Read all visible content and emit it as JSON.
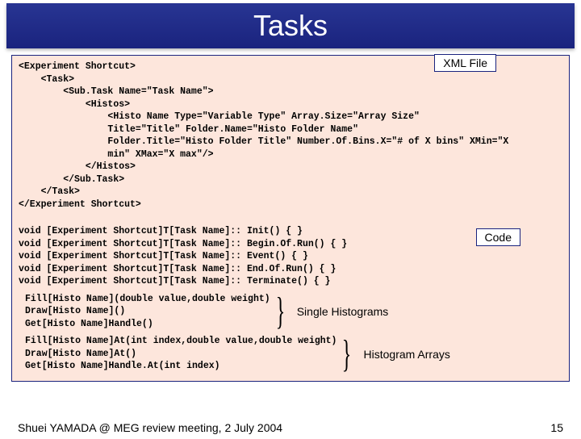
{
  "title": "Tasks",
  "labels": {
    "xml": "XML File",
    "code": "Code",
    "single": "Single Histograms",
    "arrays": "Histogram Arrays"
  },
  "xml_block": "<Experiment Shortcut>\n    <Task>\n        <Sub.Task Name=\"Task Name\">\n            <Histos>\n                <Histo Name Type=\"Variable Type\" Array.Size=\"Array Size\"\n                Title=\"Title\" Folder.Name=\"Histo Folder Name\"\n                Folder.Title=\"Histo Folder Title\" Number.Of.Bins.X=\"# of X bins\" XMin=\"X\n                min\" XMax=\"X max\"/>\n            </Histos>\n        </Sub.Task>\n    </Task>\n</Experiment Shortcut>",
  "code_block": "void [Experiment Shortcut]T[Task Name]:: Init() { }\nvoid [Experiment Shortcut]T[Task Name]:: Begin.Of.Run() { }\nvoid [Experiment Shortcut]T[Task Name]:: Event() { }\nvoid [Experiment Shortcut]T[Task Name]:: End.Of.Run() { }\nvoid [Experiment Shortcut]T[Task Name]:: Terminate() { }",
  "single_block": "Fill[Histo Name](double value,double weight)\nDraw[Histo Name]()\nGet[Histo Name]Handle()",
  "array_block": "Fill[Histo Name]At(int index,double value,double weight)\nDraw[Histo Name]At()\nGet[Histo Name]Handle.At(int index)",
  "footer": {
    "left": "Shuei YAMADA @ MEG review meeting, 2 July 2004",
    "right": "15"
  }
}
